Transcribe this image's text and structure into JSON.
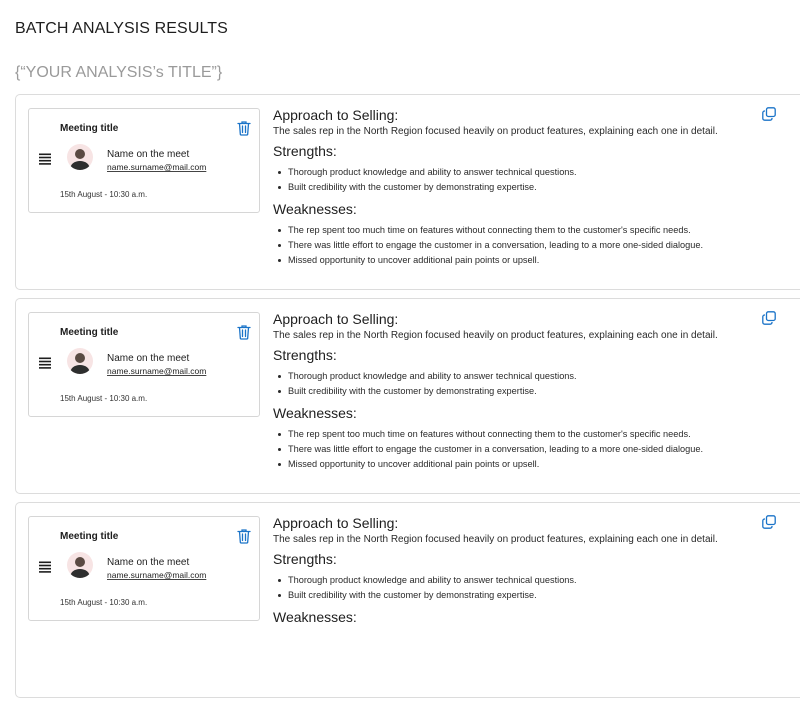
{
  "page_title": "BATCH ANALYSIS RESULTS",
  "analysis_title": "{“YOUR ANALYSIS’s TITLE”}",
  "colors": {
    "accent": "#1a73c8",
    "border": "#dcdcdc",
    "muted": "#9a9a9a"
  },
  "icons": {
    "delete": "trash-icon",
    "reorder": "drag-handle-icon",
    "copy": "copy-icon"
  },
  "results": [
    {
      "meeting": {
        "title": "Meeting title",
        "attendee_name": "Name on the meet",
        "attendee_email": "name.surname@mail.com",
        "date": "15th August - 10:30 a.m."
      },
      "approach_heading": "Approach to Selling:",
      "approach_text": "The sales rep in the North Region focused heavily on product features, explaining each one in detail.",
      "strengths_heading": "Strengths:",
      "strengths": [
        "Thorough product knowledge and ability to answer technical questions.",
        "Built credibility with the customer by demonstrating expertise."
      ],
      "weaknesses_heading": "Weaknesses:",
      "weaknesses": [
        "The rep spent too much time on features without connecting them to the customer's specific needs.",
        "There was little effort to engage the customer in a conversation, leading to a more one-sided dialogue.",
        "Missed opportunity to uncover additional pain points or upsell."
      ]
    },
    {
      "meeting": {
        "title": "Meeting title",
        "attendee_name": "Name on the meet",
        "attendee_email": "name.surname@mail.com",
        "date": "15th August - 10:30 a.m."
      },
      "approach_heading": "Approach to Selling:",
      "approach_text": "The sales rep in the North Region focused heavily on product features, explaining each one in detail.",
      "strengths_heading": "Strengths:",
      "strengths": [
        "Thorough product knowledge and ability to answer technical questions.",
        "Built credibility with the customer by demonstrating expertise."
      ],
      "weaknesses_heading": "Weaknesses:",
      "weaknesses": [
        "The rep spent too much time on features without connecting them to the customer's specific needs.",
        "There was little effort to engage the customer in a conversation, leading to a more one-sided dialogue.",
        "Missed opportunity to uncover additional pain points or upsell."
      ]
    },
    {
      "meeting": {
        "title": "Meeting title",
        "attendee_name": "Name on the meet",
        "attendee_email": "name.surname@mail.com",
        "date": "15th August - 10:30 a.m."
      },
      "approach_heading": "Approach to Selling:",
      "approach_text": "The sales rep in the North Region focused heavily on product features, explaining each one in detail.",
      "strengths_heading": "Strengths:",
      "strengths": [
        "Thorough product knowledge and ability to answer technical questions.",
        "Built credibility with the customer by demonstrating expertise."
      ],
      "weaknesses_heading": "Weaknesses:",
      "weaknesses": []
    }
  ]
}
